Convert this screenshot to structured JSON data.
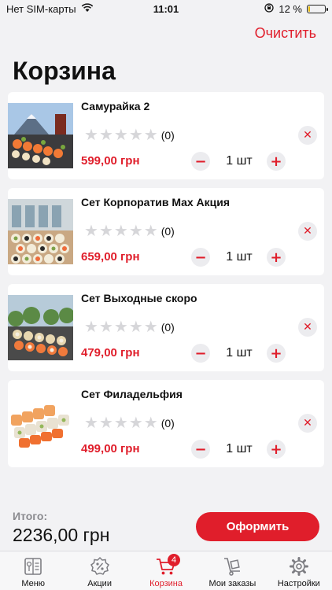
{
  "status_bar": {
    "carrier": "Нет SIM-карты",
    "time": "11:01",
    "battery": "12 %",
    "battery_level": 0.12
  },
  "header": {
    "clear_label": "Очистить",
    "title": "Корзина"
  },
  "cart": {
    "items": [
      {
        "name": "Самурайка 2",
        "rating_count": "(0)",
        "stars": 0,
        "price": "599,00 грн",
        "quantity": "1 шт"
      },
      {
        "name": "Сет Корпоратив Max Акция",
        "rating_count": "(0)",
        "stars": 0,
        "price": "659,00 грн",
        "quantity": "1 шт"
      },
      {
        "name": "Сет Выходные скоро",
        "rating_count": "(0)",
        "stars": 0,
        "price": "479,00 грн",
        "quantity": "1 шт"
      },
      {
        "name": "Сет Филадельфия",
        "rating_count": "(0)",
        "stars": 0,
        "price": "499,00 грн",
        "quantity": "1 шт"
      }
    ]
  },
  "summary": {
    "total_label": "Итого:",
    "total_value": "2236,00 грн",
    "checkout_label": "Оформить"
  },
  "tab_bar": {
    "tabs": [
      {
        "label": "Меню",
        "icon": "menu-book-icon"
      },
      {
        "label": "Акции",
        "icon": "promo-icon"
      },
      {
        "label": "Корзина",
        "icon": "cart-icon",
        "badge": "4",
        "active": true
      },
      {
        "label": "Мои заказы",
        "icon": "orders-icon"
      },
      {
        "label": "Настройки",
        "icon": "settings-gear-icon"
      }
    ]
  },
  "colors": {
    "accent": "#e01e2b",
    "background": "#f2f2f4",
    "star_empty": "#d6d6d9"
  }
}
